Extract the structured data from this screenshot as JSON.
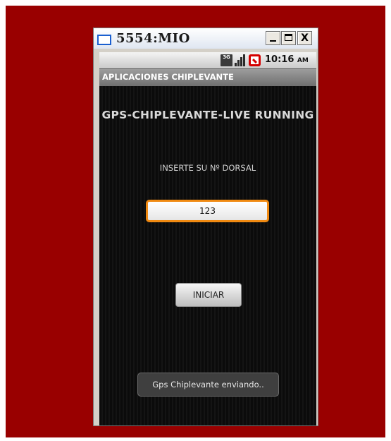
{
  "window": {
    "title": "5554:MIO",
    "controls": {
      "minimize": "_",
      "maximize": "□",
      "close": "X"
    }
  },
  "status_bar": {
    "network": "3G",
    "time": "10:16",
    "ampm": "AM",
    "icons": [
      "3g-icon",
      "signal-icon",
      "alarm-off-icon"
    ]
  },
  "app": {
    "title": "APLICACIONES CHIPLEVANTE",
    "headline": "GPS-CHIPLEVANTE-LIVE RUNNING",
    "prompt": "INSERTE SU Nº DORSAL",
    "dorsal_value": "123",
    "start_button": "INICIAR",
    "toast": "Gps Chiplevante enviando.."
  },
  "colors": {
    "backdrop": "#990000",
    "input_focus": "#f08a12",
    "screen_bg": "#0b0b0b"
  }
}
